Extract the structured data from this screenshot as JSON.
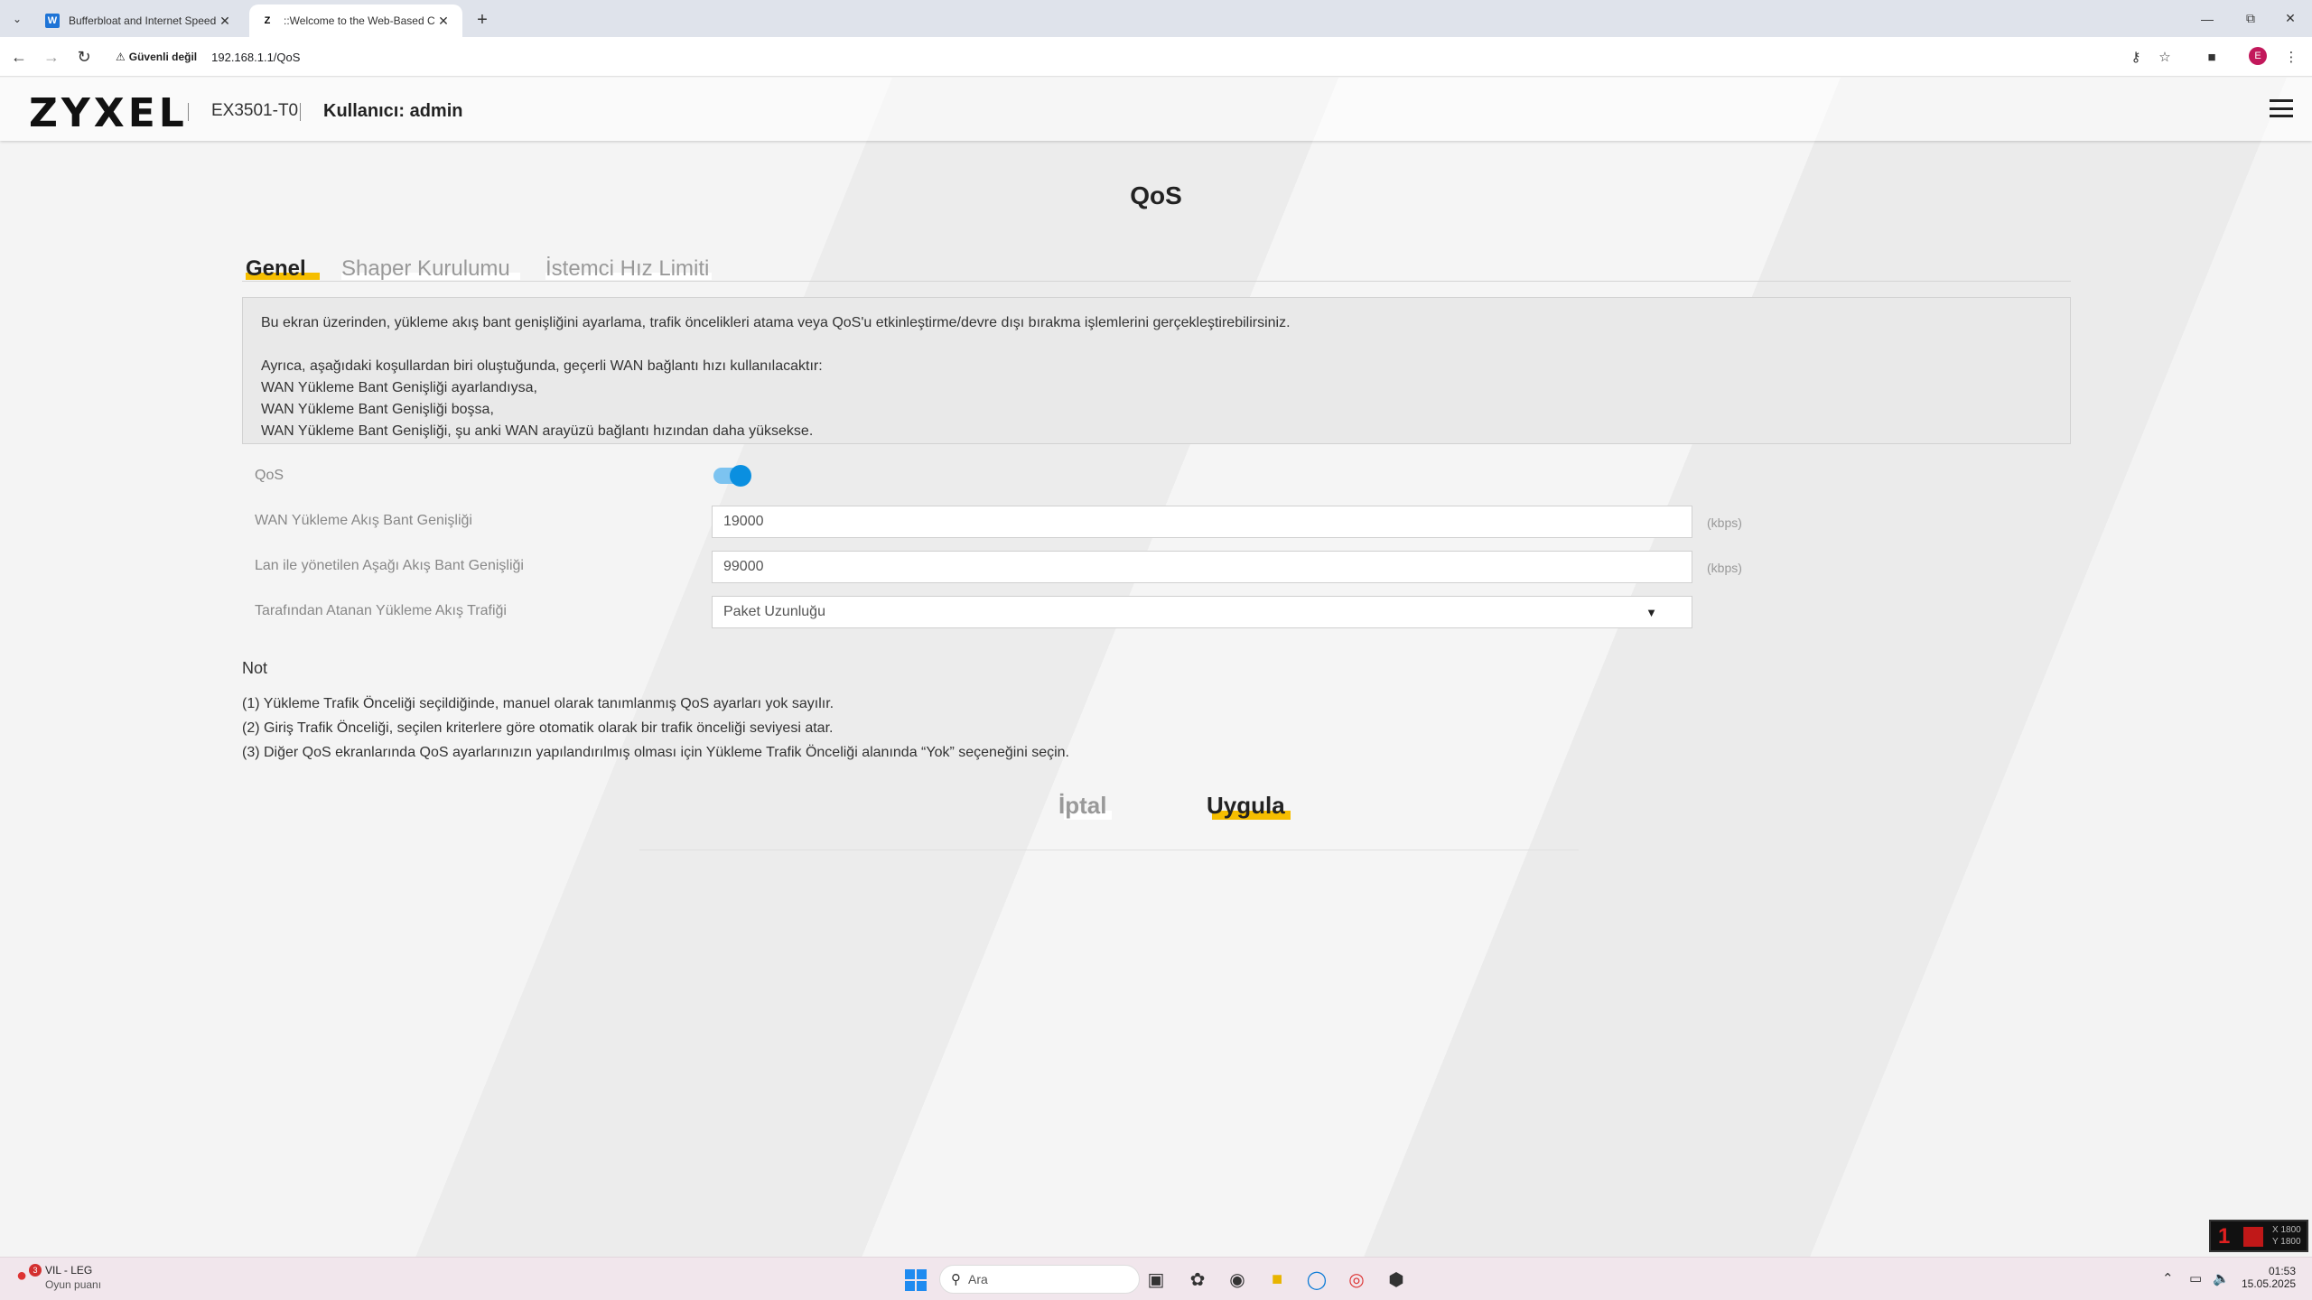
{
  "browser": {
    "tabs": [
      {
        "title": "Bufferbloat and Internet Speed",
        "favicon": "W",
        "active": false
      },
      {
        "title": "::Welcome to the Web-Based C",
        "favicon": "Z",
        "active": true
      }
    ],
    "security_label": "Güvenli değil",
    "url": "192.168.1.1/QoS",
    "profile_initial": "E"
  },
  "router": {
    "logo": "ZYXEL",
    "model": "EX3501-T0",
    "user_label": "Kullanıcı: admin"
  },
  "page": {
    "title": "QoS",
    "tabs": [
      {
        "label": "Genel",
        "active": true
      },
      {
        "label": "Shaper Kurulumu",
        "active": false
      },
      {
        "label": "İstemci Hız Limiti",
        "active": false
      }
    ],
    "info": {
      "line1": "Bu ekran üzerinden, yükleme akış bant genişliğini ayarlama, trafik öncelikleri atama veya QoS'u etkinleştirme/devre dışı bırakma işlemlerini gerçekleştirebilirsiniz.",
      "line2": "Ayrıca, aşağıdaki koşullardan biri oluştuğunda, geçerli WAN bağlantı hızı kullanılacaktır:",
      "line3": "WAN Yükleme Bant Genişliği ayarlandıysa,",
      "line4": "WAN Yükleme Bant Genişliği boşsa,",
      "line5": "WAN Yükleme Bant Genişliği, şu anki WAN arayüzü bağlantı hızından daha yüksekse."
    },
    "form": {
      "qos_label": "QoS",
      "qos_enabled": true,
      "wan_upload_label": "WAN Yükleme Akış Bant Genişliği",
      "wan_upload_value": "19000",
      "wan_upload_unit": "(kbps)",
      "lan_down_label": "Lan ile yönetilen Aşağı Akış Bant Genişliği",
      "lan_down_value": "99000",
      "lan_down_unit": "(kbps)",
      "upload_traffic_label": "Tarafından Atanan Yükleme Akış Trafiği",
      "upload_traffic_value": "Paket Uzunluğu"
    },
    "notes_title": "Not",
    "notes": [
      "(1) Yükleme Trafik Önceliği seçildiğinde, manuel olarak tanımlanmış QoS ayarları yok sayılır.",
      "(2) Giriş Trafik Önceliği, seçilen kriterlere göre otomatik olarak bir trafik önceliği seviyesi atar.",
      "(3) Diğer QoS ekranlarında QoS ayarlarınızın yapılandırılmış olması için Yükleme Trafik Önceliği alanında “Yok” seçeneğini seçin."
    ],
    "cancel_label": "İptal",
    "apply_label": "Uygula"
  },
  "overlay": {
    "fps_value": "1",
    "line1": "X 1800",
    "line2": "Y 1800"
  },
  "taskbar": {
    "weather_title": "VIL - LEG",
    "weather_sub": "Oyun puanı",
    "weather_badge": "3",
    "search_placeholder": "Ara",
    "time": "01:53",
    "date": "15.05.2025"
  },
  "colors": {
    "accent_yellow": "#f6be00",
    "toggle_blue": "#0a8fe0"
  }
}
